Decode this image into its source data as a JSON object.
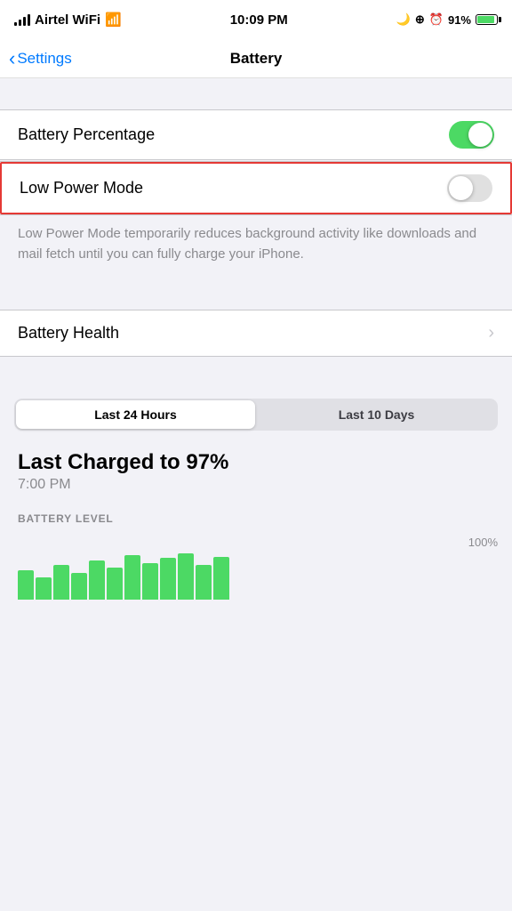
{
  "statusBar": {
    "carrier": "Airtel WiFi",
    "time": "10:09 PM",
    "battery_percent": "91%",
    "wifi_icon": "wifi-icon",
    "signal_icon": "signal-icon",
    "battery_icon": "battery-icon"
  },
  "navBar": {
    "back_label": "Settings",
    "title": "Battery",
    "back_icon": "chevron-left-icon"
  },
  "batteryPercentage": {
    "label": "Battery Percentage",
    "toggle_state": "on"
  },
  "lowPowerMode": {
    "label": "Low Power Mode",
    "toggle_state": "off",
    "description": "Low Power Mode temporarily reduces background activity like downloads and mail fetch until you can fully charge your iPhone."
  },
  "batteryHealth": {
    "label": "Battery Health",
    "chevron_icon": "chevron-right-icon"
  },
  "timeTabs": {
    "tab1_label": "Last 24 Hours",
    "tab2_label": "Last 10 Days",
    "active_tab": "tab1"
  },
  "chargeInfo": {
    "title": "Last Charged to 97%",
    "time": "7:00 PM"
  },
  "batteryLevel": {
    "section_label": "BATTERY LEVEL",
    "percent_label": "100%",
    "bars": [
      60,
      45,
      70,
      55,
      80,
      65,
      90,
      75,
      85,
      95,
      70,
      88
    ]
  }
}
